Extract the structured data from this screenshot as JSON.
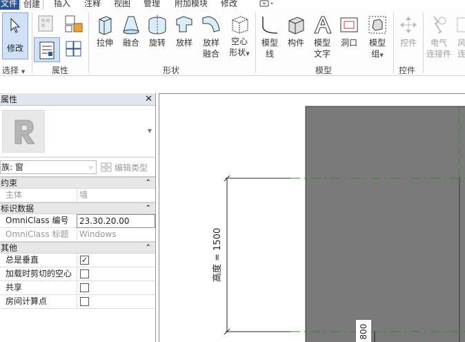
{
  "menu": {
    "tabs": [
      "文件",
      "创建",
      "插入",
      "注释",
      "视图",
      "管理",
      "附加模块",
      "修改"
    ]
  },
  "ribbon": {
    "modify": "修改",
    "select": "选择",
    "properties_group": "属性",
    "forms": {
      "extrusion": "拉伸",
      "blend": "融合",
      "revolve": "旋转",
      "sweep": "放样",
      "swept_blend_1": "放样",
      "swept_blend_2": "融合",
      "void_1": "空心",
      "void_2": "形状"
    },
    "forms_group": "形状",
    "model": {
      "model_line_1": "模型",
      "model_line_2": "线",
      "component": "构件",
      "model_text_1": "模型",
      "model_text_2": "文字",
      "opening": "洞口",
      "model_group_1": "模型",
      "model_group_2": "组"
    },
    "model_group": "模型",
    "control": "控件",
    "control_group": "控件",
    "electrical_1": "电气",
    "electrical_2": "连接件",
    "duct_1": "风",
    "duct_2": "连"
  },
  "properties": {
    "title": "属性",
    "close": "✕",
    "family": "族: 窗",
    "edit_type": "编辑类型",
    "sections": {
      "constraints": "约束",
      "identity": "标识数据",
      "other": "其他"
    },
    "host": {
      "name": "主体",
      "value": "墙"
    },
    "omniclass_number": {
      "name": "OmniClass 编号",
      "value": "23.30.20.00"
    },
    "omniclass_title": {
      "name": "OmniClass 标题",
      "value": "Windows"
    },
    "always_vertical": {
      "name": "总是垂直",
      "checked": true
    },
    "cut_with_voids": {
      "name": "加载时剪切的空心",
      "checked": false
    },
    "shared": {
      "name": "共享",
      "checked": false
    },
    "room_calc": {
      "name": "房间计算点",
      "checked": false
    }
  },
  "canvas": {
    "height_dim": "高度 = 1500",
    "bottom_dim": "800"
  },
  "colors": {
    "accent": "#2b5797",
    "wall_fill": "#7a7a7a",
    "ref_plane": "#2e8b2e"
  }
}
